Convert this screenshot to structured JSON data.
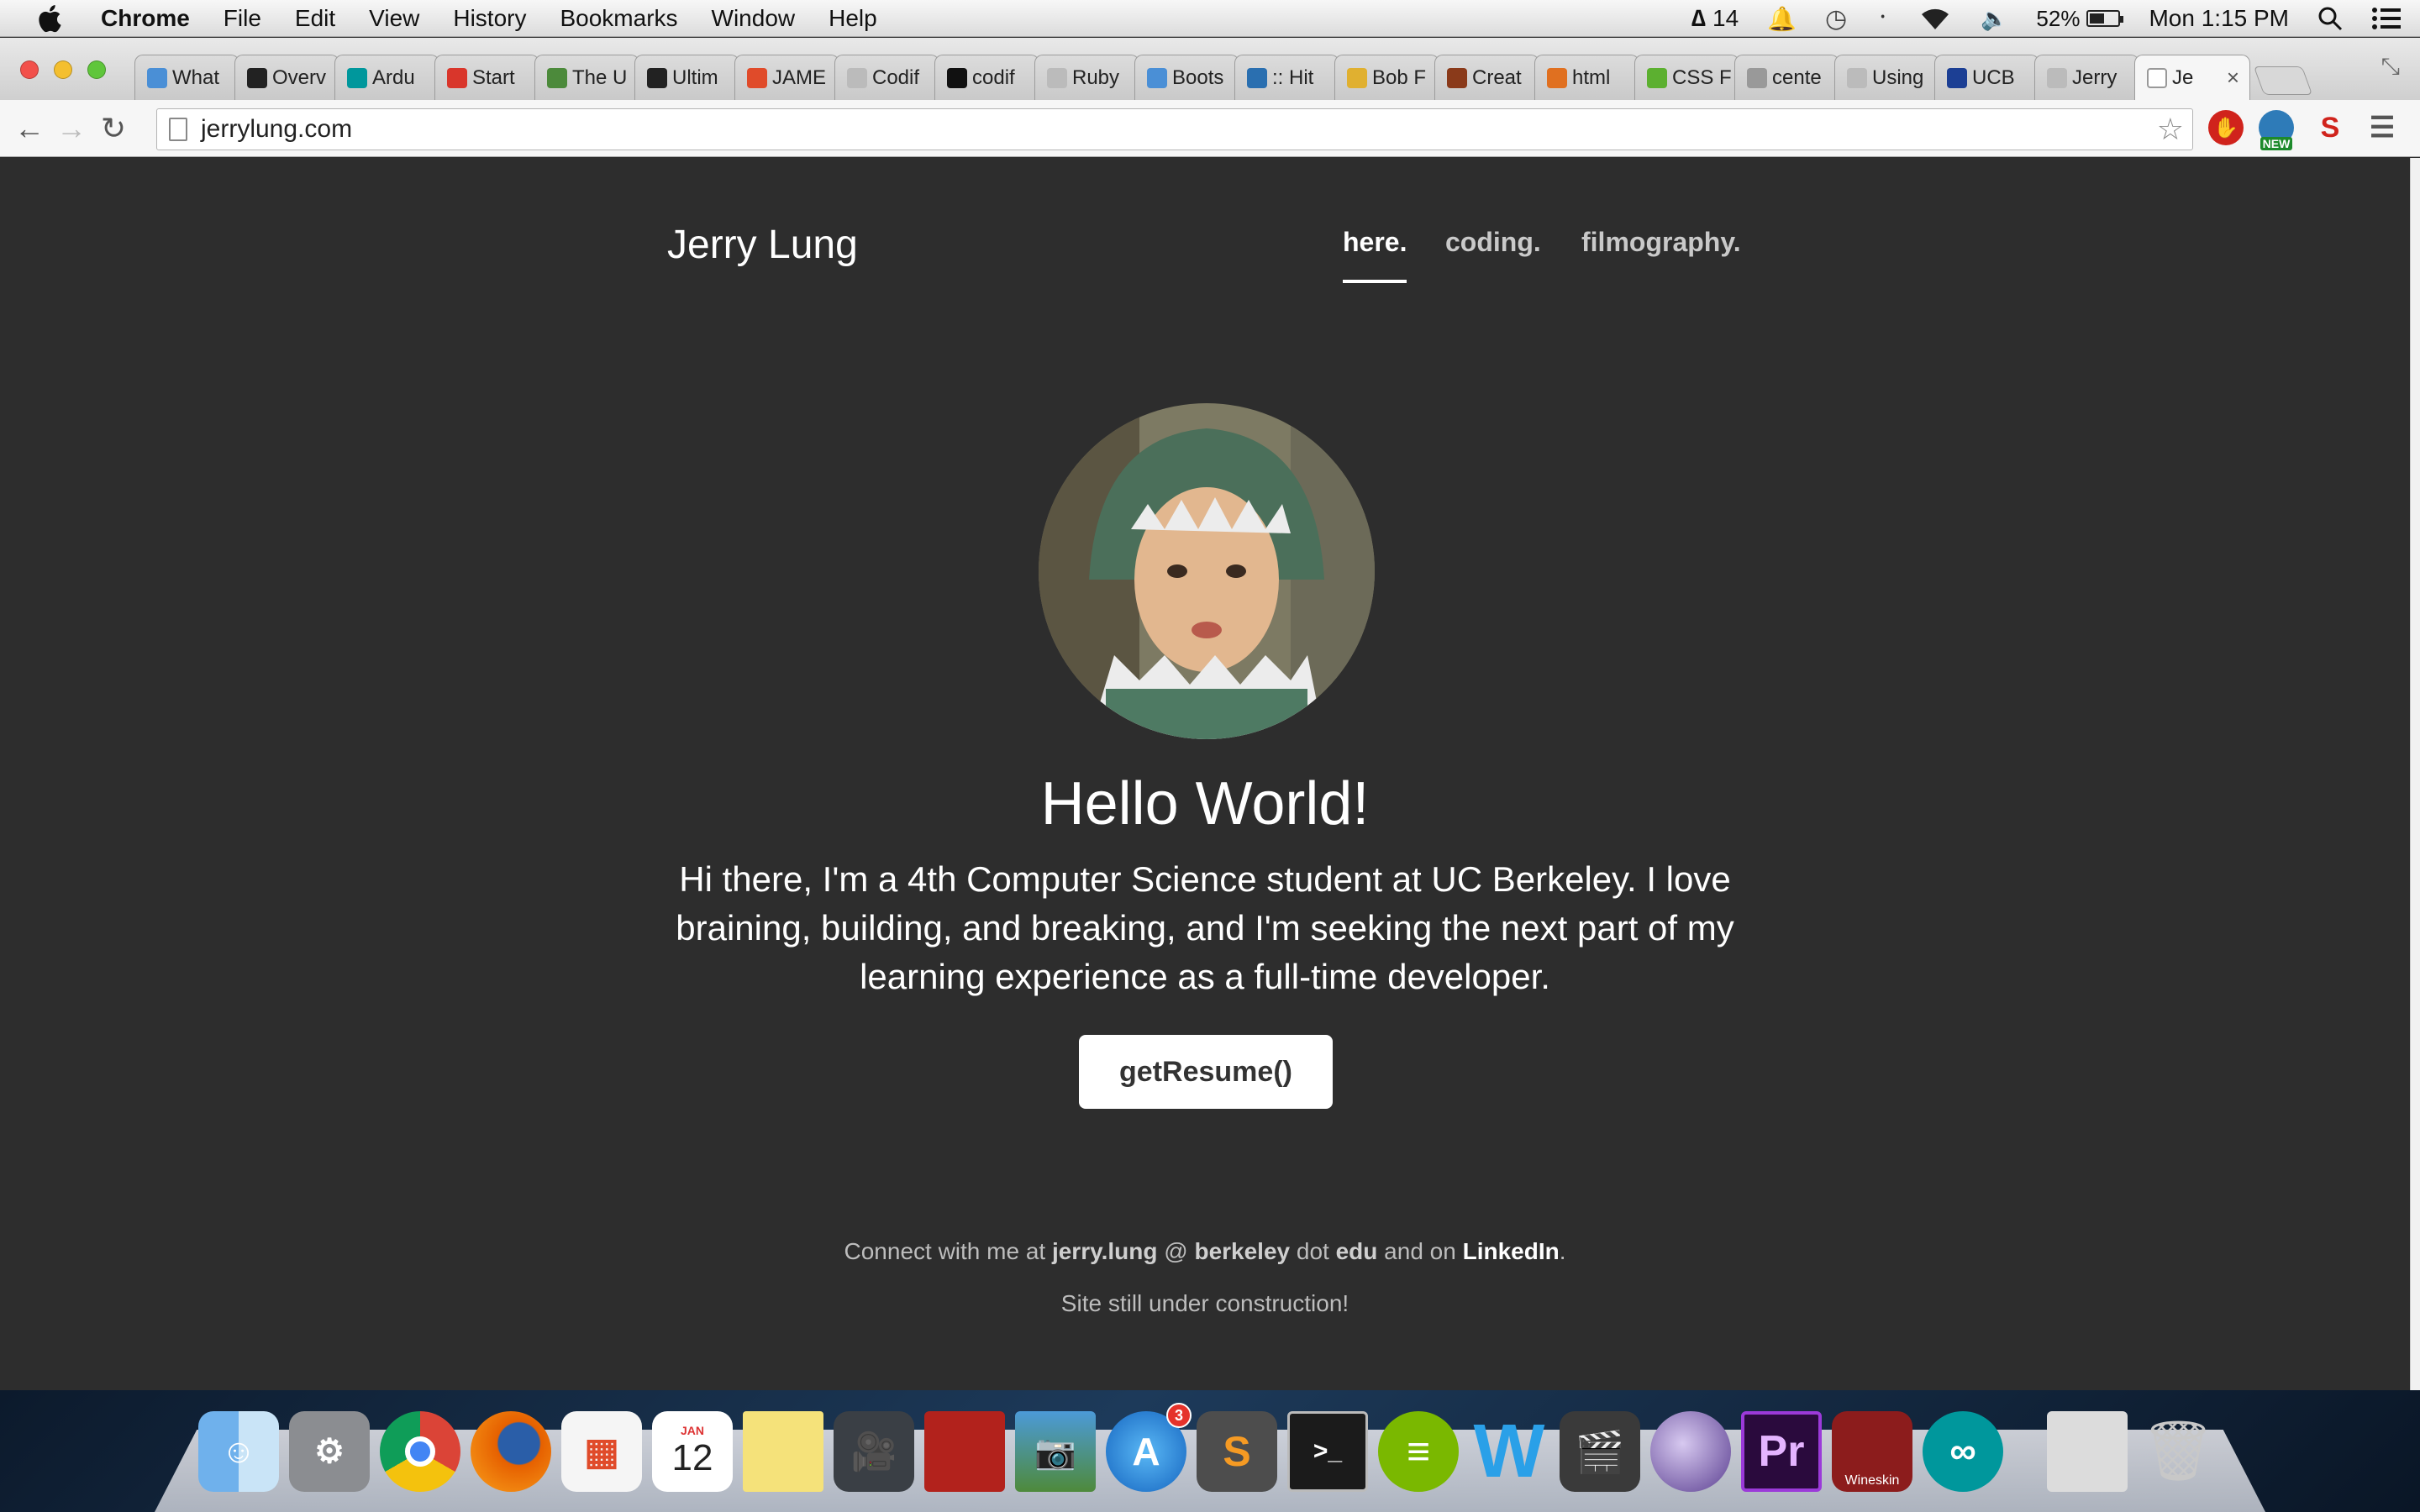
{
  "menubar": {
    "app": "Chrome",
    "items": [
      "File",
      "Edit",
      "View",
      "History",
      "Bookmarks",
      "Window",
      "Help"
    ],
    "adobe_count": "14",
    "battery": "52%",
    "battery_level": 0.52,
    "clock": "Mon 1:15 PM"
  },
  "tabs": [
    {
      "label": "What",
      "color": "#4a8fd6"
    },
    {
      "label": "Overv",
      "color": "#222222"
    },
    {
      "label": "Ardu",
      "color": "#00979c"
    },
    {
      "label": "Start",
      "color": "#d9362b"
    },
    {
      "label": "The U",
      "color": "#4c8a3b"
    },
    {
      "label": "Ultim",
      "color": "#222222"
    },
    {
      "label": "JAME",
      "color": "#e04b2a"
    },
    {
      "label": "Codif",
      "color": "#bbbbbb"
    },
    {
      "label": "codif",
      "color": "#111111"
    },
    {
      "label": "Ruby",
      "color": "#bbbbbb"
    },
    {
      "label": "Boots",
      "color": "#4a8fd6"
    },
    {
      "label": ":: Hit",
      "color": "#2a6fb0"
    },
    {
      "label": "Bob F",
      "color": "#e0b030"
    },
    {
      "label": "Creat",
      "color": "#8a3a1a"
    },
    {
      "label": "html",
      "color": "#e07020"
    },
    {
      "label": "CSS F",
      "color": "#5cb030"
    },
    {
      "label": "cente",
      "color": "#999999"
    },
    {
      "label": "Using",
      "color": "#bbbbbb"
    },
    {
      "label": "UCB",
      "color": "#1c3f94"
    },
    {
      "label": "Jerry",
      "color": "#bbbbbb"
    }
  ],
  "active_tab": {
    "label": "Je",
    "close": "×"
  },
  "address_bar": {
    "url": "jerrylung.com"
  },
  "site": {
    "brand": "Jerry Lung",
    "nav": [
      "here.",
      "coding.",
      "filmography."
    ],
    "heading": "Hello World!",
    "bio": "Hi there, I'm a 4th Computer Science student at UC Berkeley. I love braining, building, and breaking, and I'm seeking the next part of my learning experience as a full-time developer.",
    "button": "getResume()",
    "connect": {
      "prefix": "Connect with me at",
      "user": "jerry.lung",
      "at": "@",
      "domain": "berkeley",
      "dot": "dot",
      "tld": "edu",
      "and_on": "and on",
      "linkedin": "LinkedIn",
      "period": "."
    },
    "construction": "Site still under construction!"
  },
  "extensions": {
    "new_badge": "NEW",
    "s_icon": "S"
  },
  "dock": {
    "calendar_day": "12",
    "calendar_month": "JAN",
    "appstore_badge": "3",
    "wineskin": "Wineskin",
    "premiere": "Pr",
    "sublime": "S"
  }
}
